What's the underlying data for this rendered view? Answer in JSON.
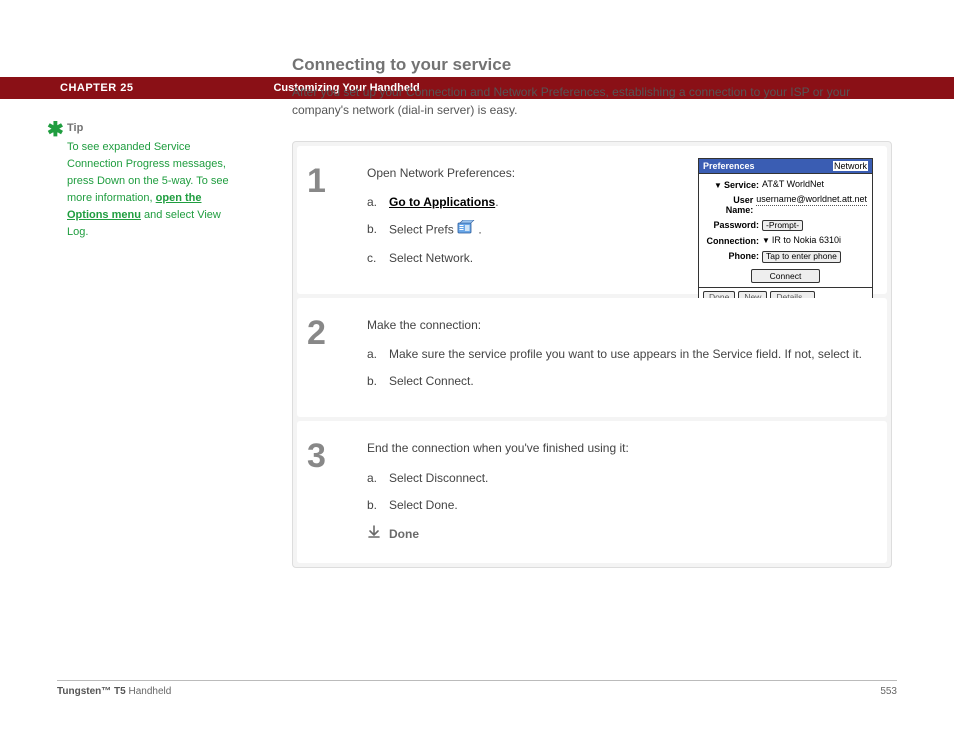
{
  "header": {
    "chapter": "CHAPTER 25",
    "title": "Customizing Your Handheld"
  },
  "section": {
    "heading": "Connecting to your service",
    "intro": "After you set up your Connection and Network Preferences, establishing a connection to your ISP or your company's network (dial-in server) is easy."
  },
  "tip": {
    "label": "Tip",
    "text_before": "To see expanded Service Connection Progress messages, press Down on the 5-way. To see more information, ",
    "link": "open the Options menu",
    "text_after": " and select View Log."
  },
  "steps": [
    {
      "num": "1",
      "head": "Open Network Preferences:",
      "items": [
        {
          "letter": "a.",
          "link": "Go to Applications",
          "after": "."
        },
        {
          "letter": "b.",
          "text_before": "Select Prefs ",
          "icon": true,
          "after": "."
        },
        {
          "letter": "c.",
          "text": "Select Network."
        }
      ],
      "screenshot": true
    },
    {
      "num": "2",
      "head": "Make the connection:",
      "items": [
        {
          "letter": "a.",
          "text": "Make sure the service profile you want to use appears in the Service field. If not, select it."
        },
        {
          "letter": "b.",
          "text": "Select Connect."
        }
      ]
    },
    {
      "num": "3",
      "head": "End the connection when you've finished using it:",
      "items": [
        {
          "letter": "a.",
          "text": "Select Disconnect."
        },
        {
          "letter": "b.",
          "text": "Select Done."
        }
      ],
      "done": "Done"
    }
  ],
  "screenshot": {
    "title_left": "Preferences",
    "title_right": "Network",
    "rows": {
      "service_label": "Service:",
      "service_value": "AT&T WorldNet",
      "username_label": "User Name:",
      "username_value": "username@worldnet.att.net",
      "password_label": "Password:",
      "password_value": "-Prompt-",
      "connection_label": "Connection:",
      "connection_value": "IR to Nokia 6310i",
      "phone_label": "Phone:",
      "phone_value": "Tap to enter phone"
    },
    "connect_btn": "Connect",
    "bottom": [
      "Done",
      "New",
      "Details..."
    ]
  },
  "footer": {
    "product_bold": "Tungsten™ T5",
    "product_rest": " Handheld",
    "page": "553"
  }
}
